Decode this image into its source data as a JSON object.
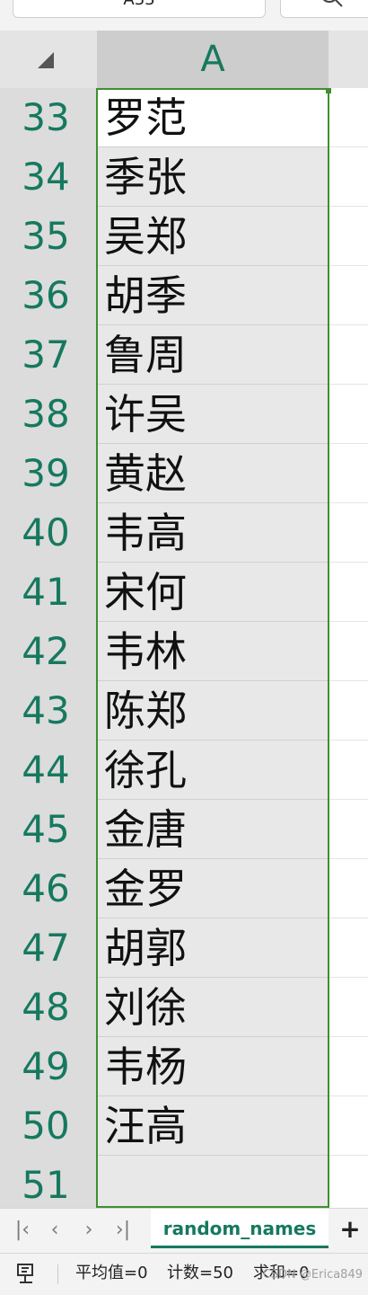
{
  "formula_bar": {
    "name_box": "A33"
  },
  "grid": {
    "column_header": "A",
    "rows": [
      {
        "num": "33",
        "value": "罗范"
      },
      {
        "num": "34",
        "value": "季张"
      },
      {
        "num": "35",
        "value": "吴郑"
      },
      {
        "num": "36",
        "value": "胡季"
      },
      {
        "num": "37",
        "value": "鲁周"
      },
      {
        "num": "38",
        "value": "许吴"
      },
      {
        "num": "39",
        "value": "黄赵"
      },
      {
        "num": "40",
        "value": "韦高"
      },
      {
        "num": "41",
        "value": "宋何"
      },
      {
        "num": "42",
        "value": "韦林"
      },
      {
        "num": "43",
        "value": "陈郑"
      },
      {
        "num": "44",
        "value": "徐孔"
      },
      {
        "num": "45",
        "value": "金唐"
      },
      {
        "num": "46",
        "value": "金罗"
      },
      {
        "num": "47",
        "value": "胡郭"
      },
      {
        "num": "48",
        "value": "刘徐"
      },
      {
        "num": "49",
        "value": "韦杨"
      },
      {
        "num": "50",
        "value": "汪高"
      },
      {
        "num": "51",
        "value": ""
      }
    ]
  },
  "sheet_tabs": {
    "active": "random_names",
    "nav_icons": [
      "first-sheet-icon",
      "prev-sheet-icon",
      "next-sheet-icon",
      "last-sheet-icon"
    ],
    "add_label": "+"
  },
  "status_bar": {
    "average": "平均值=0",
    "count": "计数=50",
    "sum": "求和=0",
    "watermark": "CSDN @Erica849"
  },
  "colors": {
    "accent": "#16795f",
    "selection": "#3f8f2f"
  }
}
